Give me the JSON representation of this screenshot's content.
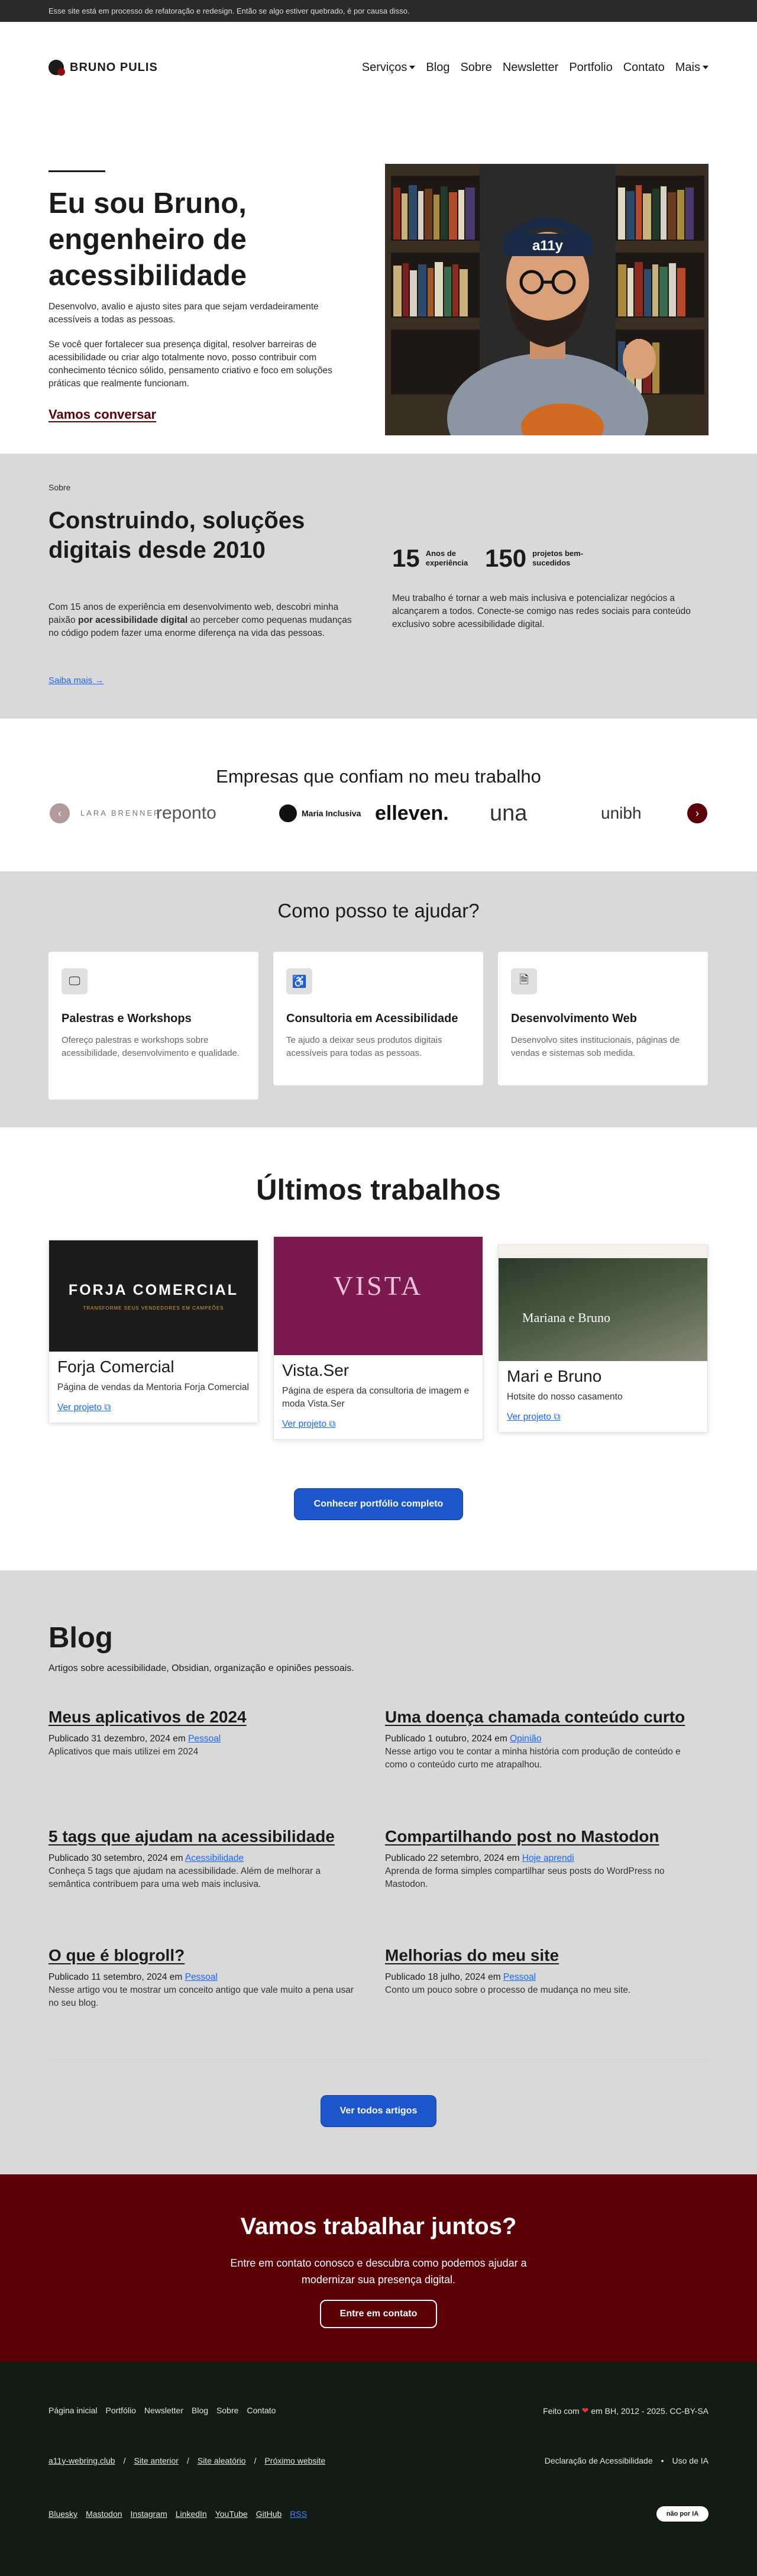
{
  "notice": "Esse site está em processo de refatoração e redesign. Então se algo estiver quebrado, é por causa disso.",
  "brand": {
    "name": "BRUNO PULIS"
  },
  "nav": {
    "services": "Serviços",
    "blog": "Blog",
    "about": "Sobre",
    "newsletter": "Newsletter",
    "portfolio": "Portfolio",
    "contact": "Contato",
    "more": "Mais"
  },
  "hero": {
    "title": "Eu sou Bruno, engenheiro de acessibilidade",
    "lead": "Desenvolvo, avalio e ajusto sites para que sejam verdadeiramente acessíveis a todas as pessoas.",
    "body": "Se você quer fortalecer sua presença digital, resolver barreiras de acessibilidade ou criar algo totalmente novo, posso contribuir com conhecimento técnico sólido, pensamento criativo e foco em soluções práticas que realmente funcionam.",
    "cta": "Vamos conversar"
  },
  "about": {
    "kicker": "Sobre",
    "title": "Construindo, soluções digitais desde 2010",
    "text_before": "Com 15 anos de experiência em desenvolvimento web, descobri minha paixão ",
    "text_bold": "por acessibilidade digital",
    "text_after": " ao perceber como pequenas mudanças no código podem fazer uma enorme diferença na vida das pessoas.",
    "more": "Saiba mais  →",
    "stats": [
      {
        "value": "15",
        "label": "Anos de experiência"
      },
      {
        "value": "150",
        "label": "projetos bem-sucedidos"
      }
    ],
    "text2": "Meu trabalho é tornar a web mais inclusiva e potencializar negócios a alcançarem a todos. Conecte-se comigo nas redes sociais para conteúdo exclusivo sobre acessibilidade digital."
  },
  "clients": {
    "title": "Empresas que confiam no meu trabalho",
    "logos": [
      "LARA BRENNER",
      "reponto",
      "Maria Inclusiva",
      "elleven.",
      "una",
      "unibh"
    ]
  },
  "help": {
    "title": "Como posso te ajudar?",
    "cards": [
      {
        "icon": "monitor-icon",
        "title": "Palestras e Workshops",
        "text": "Ofereço palestras e workshops sobre acessibilidade, desenvolvimento e qualidade."
      },
      {
        "icon": "accessibility-icon",
        "title": "Consultoria em Acessibilidade",
        "text": "Te ajudo a deixar seus produtos digitais acessíveis para todas as pessoas."
      },
      {
        "icon": "document-icon",
        "title": "Desenvolvimento Web",
        "text": "Desenvolvo sites institucionais, páginas de vendas e sistemas sob medida."
      }
    ]
  },
  "works": {
    "title": "Últimos trabalhos",
    "items": [
      {
        "title": "Forja Comercial",
        "text": "Página de vendas da Mentoria Forja Comercial",
        "link": "Ver projeto",
        "img_title": "FORJA COMERCIAL",
        "img_sub": "TRANSFORME SEUS VENDEDORES EM CAMPEÕES"
      },
      {
        "title": "Vista.Ser",
        "text": "Página de espera da consultoria de imagem e moda Vista.Ser",
        "link": "Ver projeto",
        "img_title": "VISTA"
      },
      {
        "title": "Mari e Bruno",
        "text": "Hotsite do nosso casamento",
        "link": "Ver projeto",
        "img_title": "Mariana e Bruno"
      }
    ],
    "button": "Conhecer portfólio completo"
  },
  "blog": {
    "title": "Blog",
    "subtitle": "Artigos sobre acessibilidade, Obsidian, organização e opiniões pessoais.",
    "posts": [
      {
        "title": "Meus aplicativos de 2024",
        "date": "Publicado 31 dezembro, 2024 em ",
        "category": "Pessoal",
        "desc": "Aplicativos que mais utilizei em 2024"
      },
      {
        "title": "Uma doença chamada conteúdo curto",
        "date": "Publicado 1 outubro, 2024 em ",
        "category": "Opinião",
        "desc": "Nesse artigo vou te contar a minha história com produção de conteúdo e como o conteúdo curto me atrapalhou."
      },
      {
        "title": "5 tags que ajudam na acessibilidade",
        "date": "Publicado 30 setembro, 2024 em ",
        "category": "Acessibilidade",
        "desc": "Conheça 5 tags que ajudam na acessibilidade. Além de melhorar a semântica contribuem para uma web mais inclusiva."
      },
      {
        "title": "Compartilhando post no Mastodon",
        "date": "Publicado 22 setembro, 2024 em ",
        "category": "Hoje aprendi",
        "desc": "Aprenda de forma simples compartilhar seus posts do WordPress no Mastodon."
      },
      {
        "title": "O que é blogroll?",
        "date": "Publicado 11 setembro, 2024 em ",
        "category": "Pessoal",
        "desc": "Nesse artigo vou te mostrar um conceito antigo que vale muito a pena usar no seu blog."
      },
      {
        "title": "Melhorias do meu site",
        "date": "Publicado 18 julho, 2024 em ",
        "category": "Pessoal",
        "desc": "Conto um pouco sobre o processo de mudança no meu site."
      }
    ],
    "button": "Ver todos artigos"
  },
  "cta": {
    "title": "Vamos trabalhar juntos?",
    "text": "Entre em contato conosco e descubra como podemos ajudar a modernizar sua presença digital.",
    "button": "Entre em contato"
  },
  "footer": {
    "links": [
      "Página inicial",
      "Portfólio",
      "Newsletter",
      "Blog",
      "Sobre",
      "Contato"
    ],
    "made_before": "Feito com ",
    "made_after": " em BH, 2012 - 2025. CC-BY-SA",
    "webring": [
      "a11y-webring.club",
      "Site anterior",
      "Site aleatório",
      "Próximo website"
    ],
    "legal": [
      "Declaração de Acessibilidade",
      "Uso de IA"
    ],
    "social": [
      "Bluesky",
      "Mastodon",
      "Instagram",
      "LinkedIn",
      "YouTube",
      "GitHub",
      "RSS"
    ],
    "badge": "não por IA"
  },
  "colors": {
    "accent": "#5c0008",
    "primary_button": "#1c56cc",
    "band_gray": "#d9d9d9",
    "footer_bg": "#121c15"
  }
}
